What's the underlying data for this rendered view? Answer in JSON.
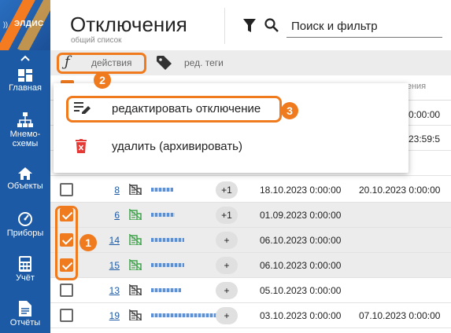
{
  "app": {
    "logo_text": "ЭЛДИС"
  },
  "sidebar": {
    "collapse_icon": "chevron-up-icon",
    "items": [
      {
        "label": "Главная",
        "icon": "dashboard-icon"
      },
      {
        "label": "Мнемо-\nсхемы",
        "icon": "sitemap-icon"
      },
      {
        "label": "Объекты",
        "icon": "home-icon"
      },
      {
        "label": "Приборы",
        "icon": "gauge-icon"
      },
      {
        "label": "Учёт",
        "icon": "calculator-icon"
      },
      {
        "label": "Отчёты",
        "icon": "report-icon"
      }
    ]
  },
  "header": {
    "title": "Отключения",
    "subtitle": "общий список",
    "search_placeholder": "Поиск и фильтр"
  },
  "toolbar": {
    "actions_label": "действия",
    "tags_label": "ред. теги"
  },
  "table": {
    "partial_header": "шения",
    "partial_cells": [
      "0:00:00",
      "23:59:5"
    ],
    "rows": [
      {
        "id": "8",
        "selected": false,
        "badge": "+1",
        "start": "18.10.2023 0:00:00",
        "end": "20.10.2023 0:00:00",
        "name_w": 28
      },
      {
        "id": "6",
        "selected": true,
        "badge": "+1",
        "start": "01.09.2023 0:00:00",
        "end": "",
        "name_w": 30
      },
      {
        "id": "14",
        "selected": true,
        "badge": "+",
        "start": "06.10.2023 0:00:00",
        "end": "",
        "name_w": 42
      },
      {
        "id": "15",
        "selected": true,
        "badge": "+",
        "start": "06.10.2023 0:00:00",
        "end": "",
        "name_w": 42
      },
      {
        "id": "13",
        "selected": false,
        "badge": "+",
        "start": "05.10.2023 0:00:00",
        "end": "",
        "name_w": 38
      },
      {
        "id": "19",
        "selected": false,
        "badge": "+",
        "start": "03.10.2023 0:00:00",
        "end": "07.10.2023 0:00:00",
        "name_w": 84
      }
    ]
  },
  "menu": {
    "items": [
      {
        "label": "редактировать отключение",
        "icon": "edit-list-icon"
      },
      {
        "label": "удалить (архивировать)",
        "icon": "delete-icon"
      }
    ]
  },
  "callouts": [
    "1",
    "2",
    "3"
  ],
  "colors": {
    "accent": "#f07a1e",
    "sidebar": "#1d5aa5",
    "link": "#1d5aa5",
    "delete": "#e53935",
    "status_icon_green": "#3ea44a"
  }
}
